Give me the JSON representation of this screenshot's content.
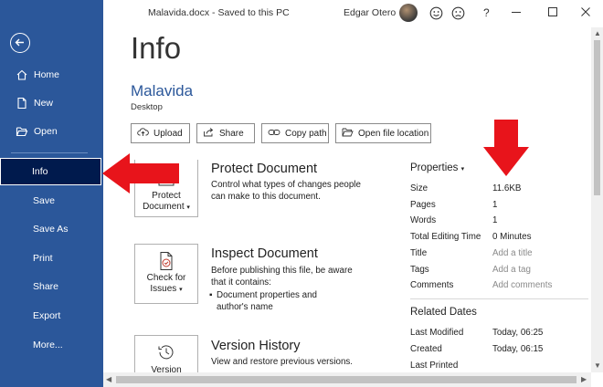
{
  "titlebar": {
    "document": "Malavida.docx  -  Saved to this PC",
    "user": "Edgar Otero",
    "help_icon": "?"
  },
  "sidebar": {
    "items": [
      {
        "label": "Home",
        "icon": "home-icon"
      },
      {
        "label": "New",
        "icon": "new-document-icon"
      },
      {
        "label": "Open",
        "icon": "folder-open-icon"
      },
      {
        "label": "Info"
      },
      {
        "label": "Save"
      },
      {
        "label": "Save As"
      },
      {
        "label": "Print"
      },
      {
        "label": "Share"
      },
      {
        "label": "Export"
      },
      {
        "label": "More..."
      }
    ]
  },
  "main": {
    "title": "Info",
    "doc_name": "Malavida",
    "doc_location": "Desktop",
    "buttons": [
      {
        "label": "Upload",
        "icon": "upload-icon"
      },
      {
        "label": "Share",
        "icon": "share-icon"
      },
      {
        "label": "Copy path",
        "icon": "link-icon"
      },
      {
        "label": "Open file location",
        "icon": "folder-icon"
      }
    ],
    "protect": {
      "card_label": "Protect",
      "card_label2": "Document",
      "title": "Protect Document",
      "desc": "Control what types of changes people can make to this document."
    },
    "inspect": {
      "card_label": "Check for",
      "card_label2": "Issues",
      "title": "Inspect Document",
      "desc": "Before publishing this file, be aware that it contains:",
      "bullet": "Document properties and author's name"
    },
    "version": {
      "card_label": "Version",
      "title": "Version History",
      "desc": "View and restore previous versions."
    }
  },
  "properties": {
    "header": "Properties",
    "rows": [
      {
        "label": "Size",
        "value": "11.6KB"
      },
      {
        "label": "Pages",
        "value": "1"
      },
      {
        "label": "Words",
        "value": "1"
      },
      {
        "label": "Total Editing Time",
        "value": "0 Minutes"
      },
      {
        "label": "Title",
        "value": "Add a title"
      },
      {
        "label": "Tags",
        "value": "Add a tag"
      },
      {
        "label": "Comments",
        "value": "Add comments"
      }
    ]
  },
  "related_dates": {
    "header": "Related Dates",
    "rows": [
      {
        "label": "Last Modified",
        "value": "Today, 06:25"
      },
      {
        "label": "Created",
        "value": "Today, 06:15"
      },
      {
        "label": "Last Printed",
        "value": ""
      }
    ]
  },
  "colors": {
    "accent": "#2b579a",
    "arrow": "#e8141b"
  }
}
